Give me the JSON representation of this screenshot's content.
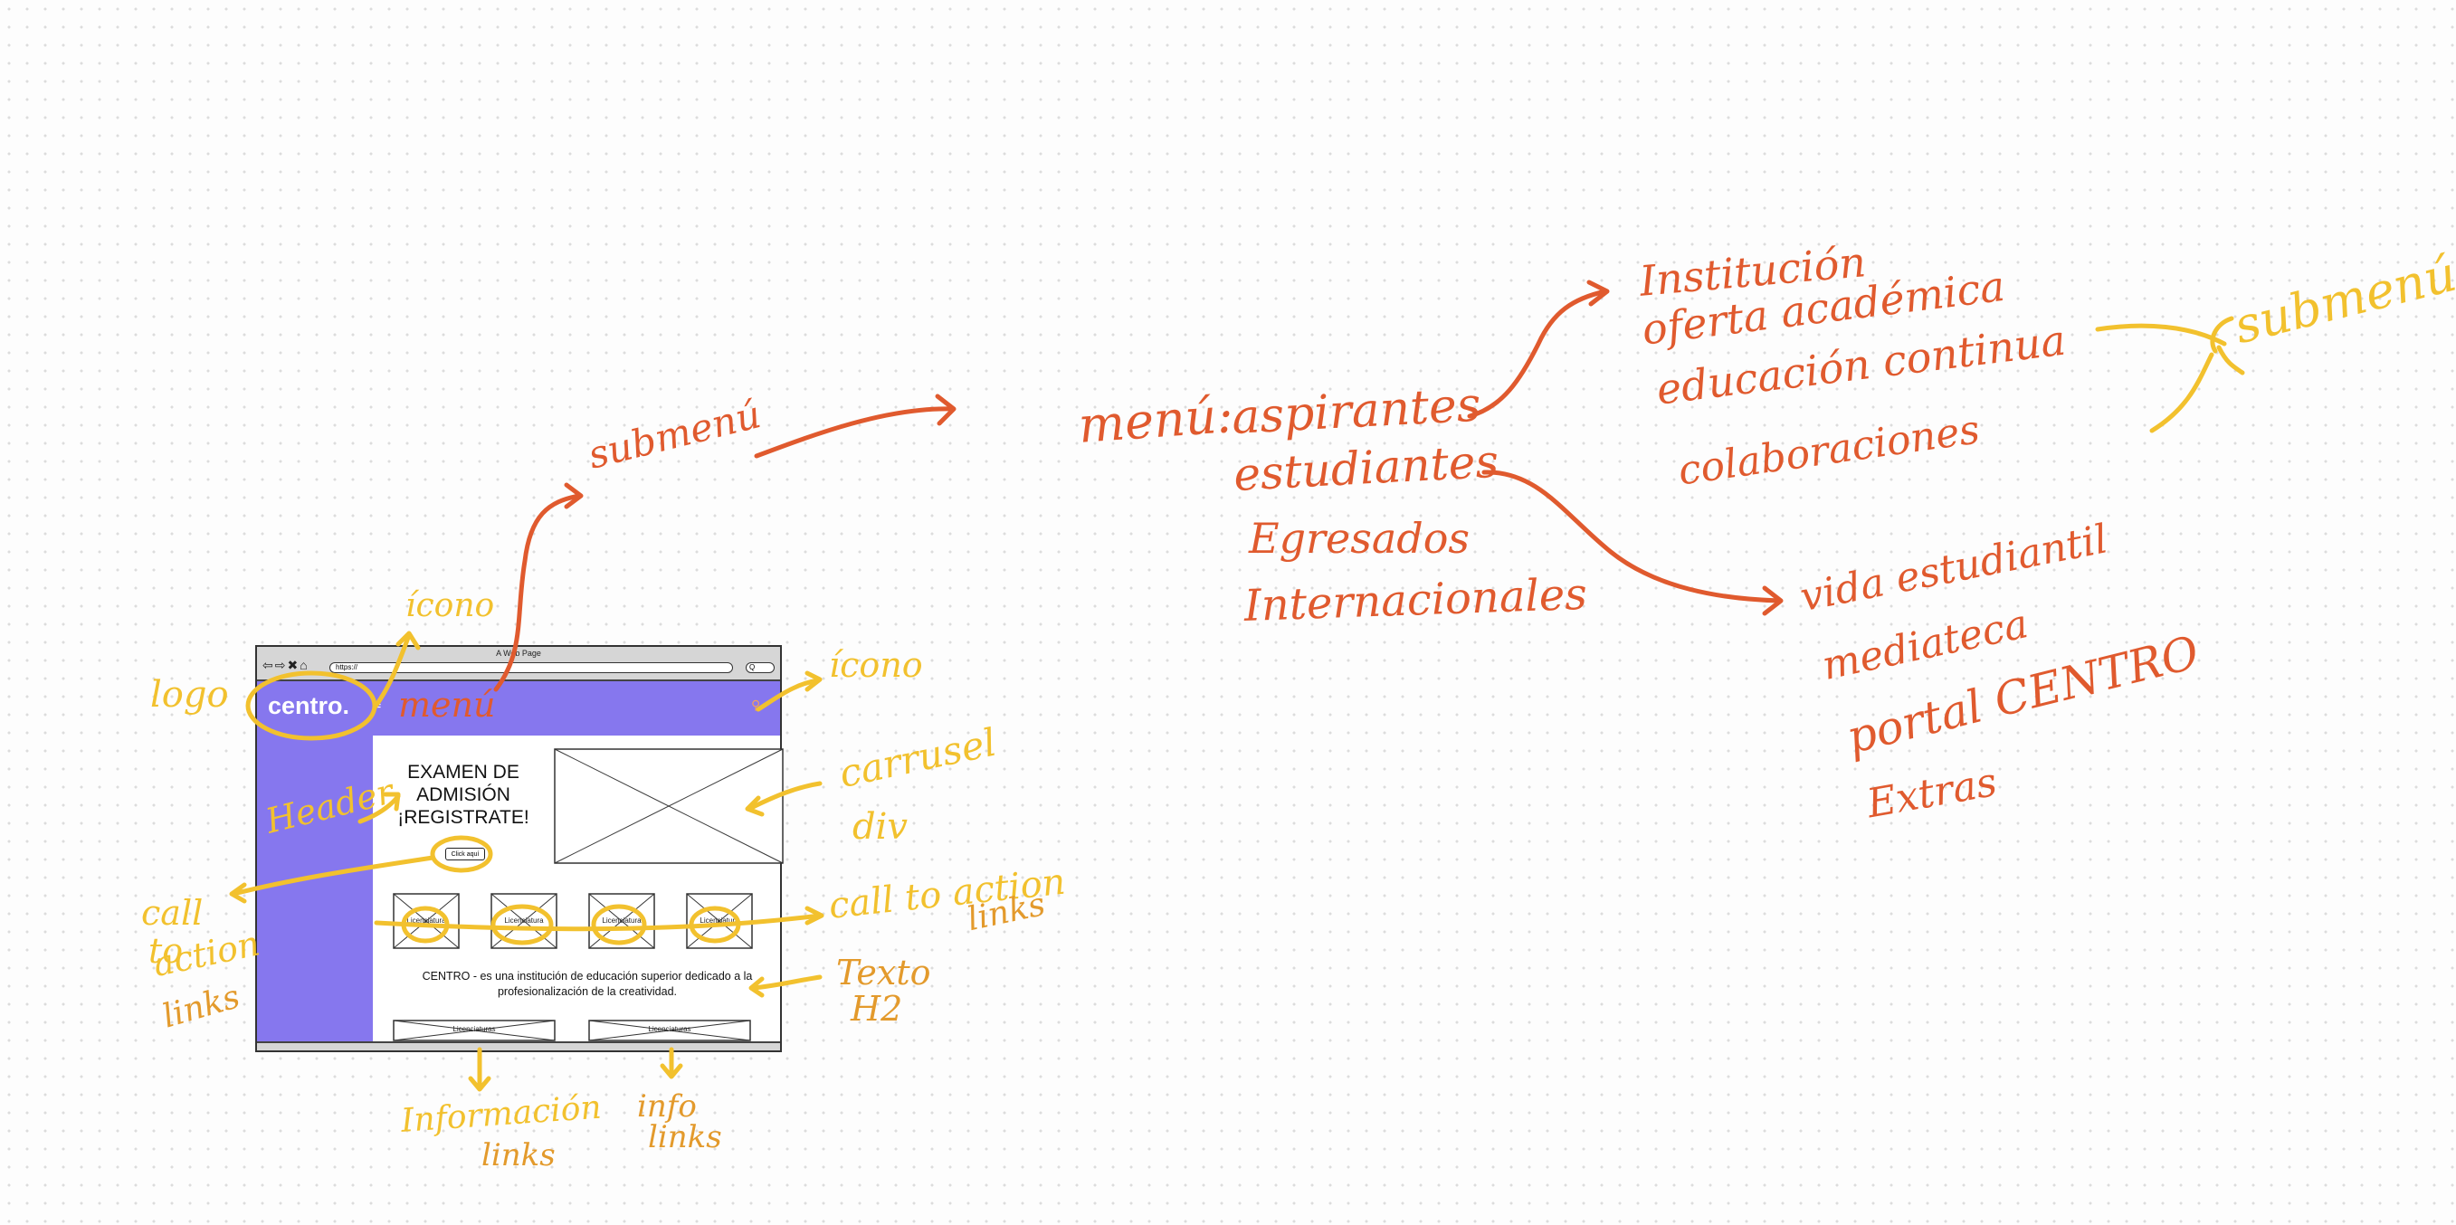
{
  "wireframe": {
    "window_title": "A Web Page",
    "url": "https://",
    "nav_icons": "⇦⇨✖⌂",
    "search_placeholder": "Q",
    "logo": "centro.",
    "menu_icon": "≡",
    "search_icon": "⚲",
    "hero": [
      "EXAMEN DE",
      "ADMISIÓN",
      "¡REGISTRATE!"
    ],
    "cta_button": "Click aquí",
    "description": [
      "CENTRO - es una institución de educación superior dedicado a la",
      "profesionalización de la creatividad."
    ],
    "cards": [
      "Licenciatura",
      "Licenciatura",
      "Licenciatura",
      "Licenciatura"
    ],
    "info_links": [
      "Licenciaturas",
      "Licenciaturas"
    ],
    "colors": {
      "brand_purple": "#8677ee",
      "chrome_gray": "#d6d6d6"
    }
  },
  "annotations": {
    "logo": "logo",
    "icono_menu": "ícono",
    "menu_wire": "menú",
    "submenu_label": "submenú",
    "icono_search": "ícono",
    "header": "Header",
    "carrusel": [
      "carrusel",
      "div"
    ],
    "cta_left": [
      "call",
      "to",
      "action",
      "links"
    ],
    "cta_right": [
      "call to action",
      "links"
    ],
    "texto": [
      "Texto",
      "H2"
    ],
    "info_a": [
      "Información",
      "links"
    ],
    "info_b": [
      "info",
      "links"
    ]
  },
  "menu_map": {
    "label": "menú:",
    "items": [
      "aspirantes",
      "estudiantes",
      "Egresados",
      "Internacionales"
    ],
    "aspirantes_sub": [
      "Institución",
      "oferta académica",
      "educación continua",
      "colaboraciones"
    ],
    "estudiantes_sub": [
      "vida estudiantil",
      "mediateca",
      "portal CENTRO",
      "Extras"
    ],
    "submenu_label": "submenú",
    "colors": {
      "red": "#e05a2e",
      "yellow": "#f2c12e",
      "orange": "#e39a2c"
    }
  }
}
